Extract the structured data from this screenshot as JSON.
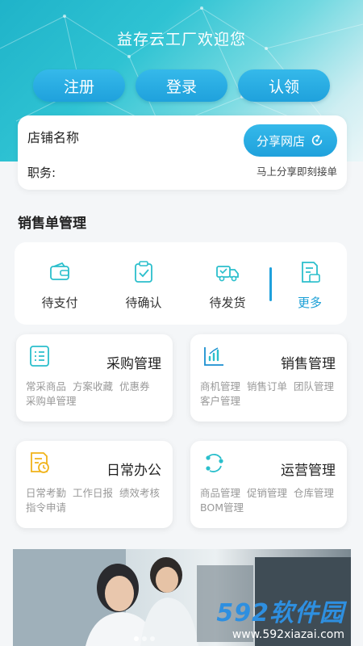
{
  "header": {
    "welcome": "益存云工厂欢迎您",
    "buttons": {
      "register": "注册",
      "login": "登录",
      "claim": "认领"
    }
  },
  "shop": {
    "name_label": "店铺名称",
    "duty_label": "职务:",
    "share_button": "分享网店",
    "share_tip": "马上分享即刻接单"
  },
  "sales": {
    "section_title": "销售单管理",
    "orders": [
      {
        "label": "待支付",
        "icon": "wallet-icon"
      },
      {
        "label": "待确认",
        "icon": "clipboard-check-icon"
      },
      {
        "label": "待发货",
        "icon": "truck-icon"
      },
      {
        "label": "更多",
        "icon": "document-list-icon"
      }
    ]
  },
  "modules": [
    {
      "title": "采购管理",
      "desc": "常采商品 方案收藏 优惠券 采购单管理",
      "icon": "checklist-icon"
    },
    {
      "title": "销售管理",
      "desc": "商机管理 销售订单 团队管理 客户管理",
      "icon": "bar-chart-icon"
    },
    {
      "title": "日常办公",
      "desc": "日常考勤 工作日报 绩效考核 指令申请",
      "icon": "document-clock-icon"
    },
    {
      "title": "运营管理",
      "desc": "商品管理 促销管理 仓库管理 BOM管理",
      "icon": "cycle-icon"
    }
  ],
  "banner": {
    "watermark_brand": "592软件园",
    "watermark_url": "www.592xiazai.com"
  },
  "colors": {
    "accent": "#1fa1dc",
    "teal": "#2bbfcc",
    "header_top": "#1fb3c9"
  }
}
